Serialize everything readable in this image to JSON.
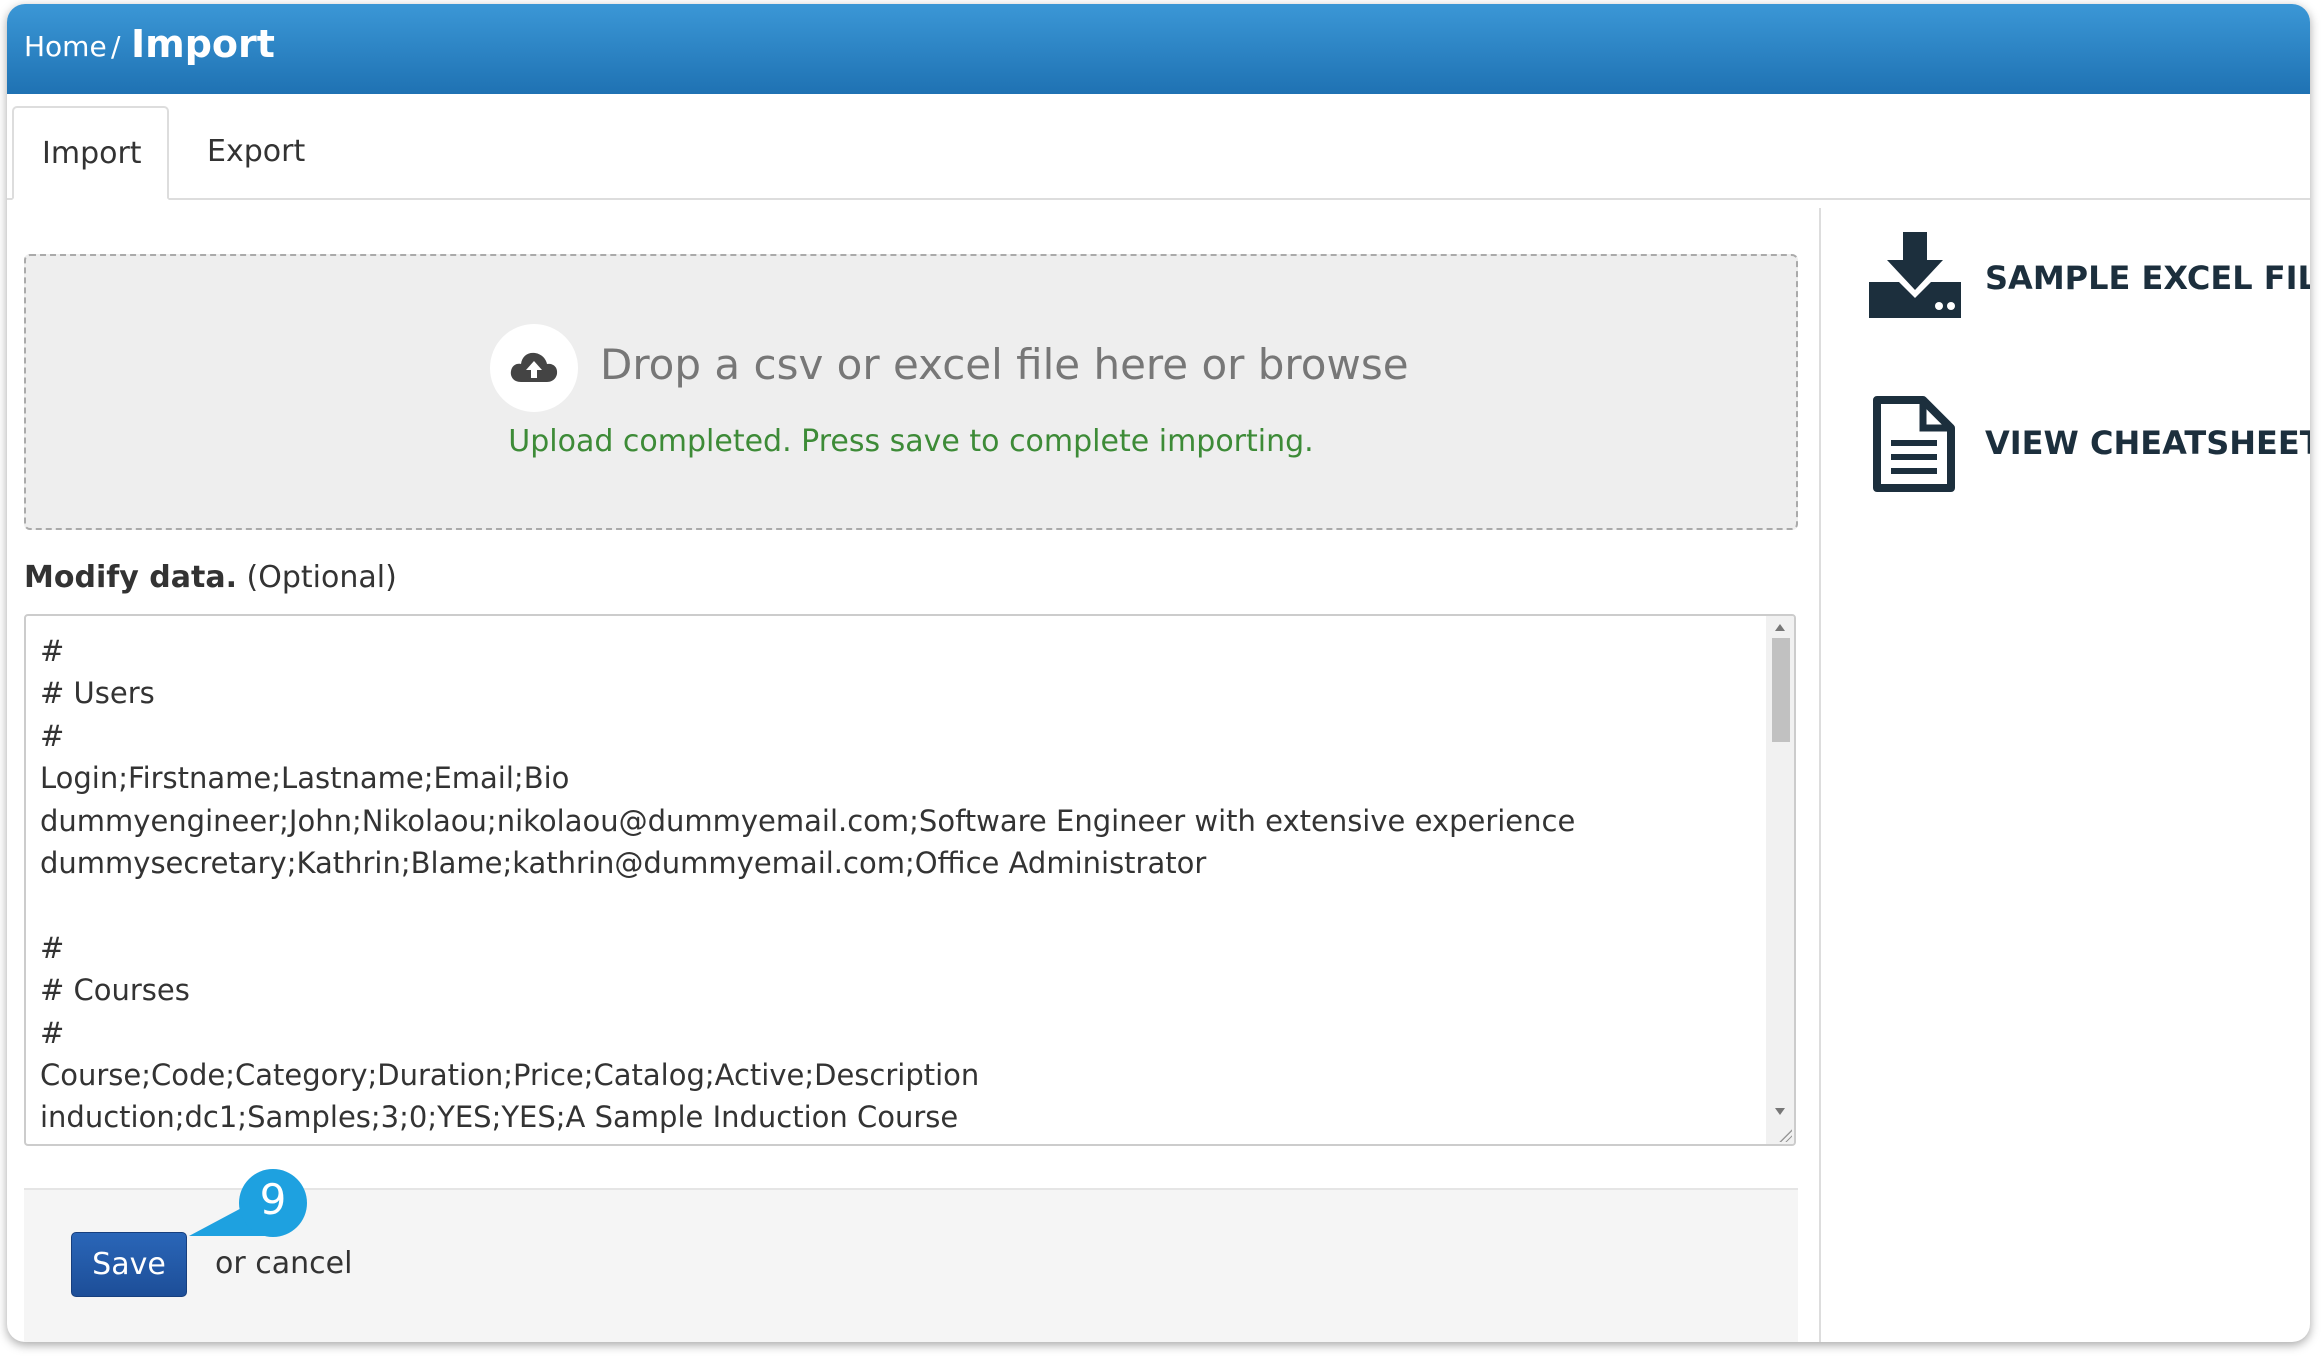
{
  "breadcrumb": {
    "home": "Home",
    "separator": "/",
    "current": "Import"
  },
  "tabs": [
    {
      "label": "Import",
      "active": true
    },
    {
      "label": "Export",
      "active": false
    }
  ],
  "dropzone": {
    "prompt": "Drop a csv or excel file here or browse",
    "status": "Upload completed. Press save to complete importing.",
    "icon": "cloud-upload-icon"
  },
  "modify": {
    "label_bold": "Modify data.",
    "label_optional": "(Optional)",
    "text": "#\n# Users\n#\nLogin;Firstname;Lastname;Email;Bio\ndummyengineer;John;Nikolaou;nikolaou@dummyemail.com;Software Engineer with extensive experience\ndummysecretary;Kathrin;Blame;kathrin@dummyemail.com;Office Administrator\n\n#\n# Courses\n#\nCourse;Code;Category;Duration;Price;Catalog;Active;Description\ninduction;dc1;Samples;3;0;YES;YES;A Sample Induction Course"
  },
  "actions": {
    "save_label": "Save",
    "or_text": "or",
    "cancel_label": "cancel"
  },
  "step_badge": "9",
  "sidebar": {
    "sample_excel": {
      "label": "SAMPLE EXCEL FILE",
      "icon": "download-icon"
    },
    "cheatsheet": {
      "label": "VIEW CHEATSHEET",
      "icon": "document-icon"
    }
  },
  "colors": {
    "header": "#2a84c6",
    "status_green": "#3d8b37",
    "save_button": "#2160ad",
    "badge": "#1ea1e0",
    "side_icon": "#1c2f3d"
  }
}
